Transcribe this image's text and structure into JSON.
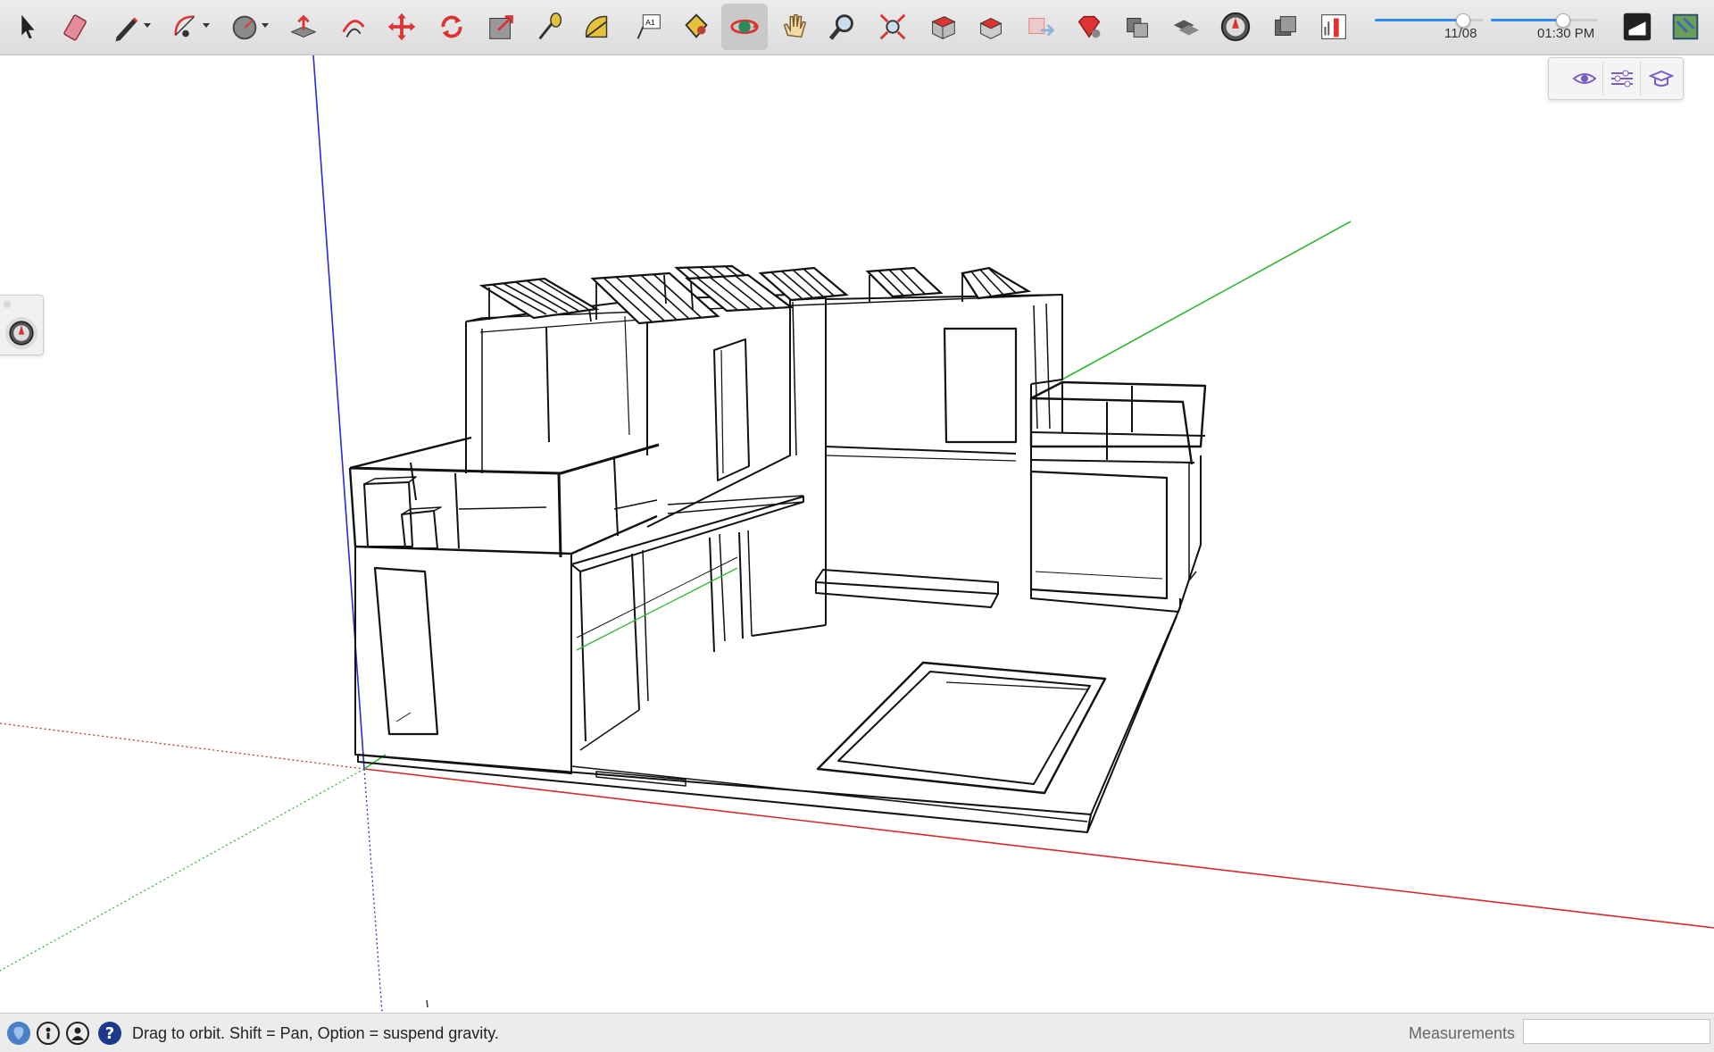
{
  "toolbar": {
    "tools": [
      {
        "name": "select-tool",
        "icon": "arrow-cursor-icon"
      },
      {
        "name": "eraser-tool",
        "icon": "eraser-icon"
      },
      {
        "name": "line-tool",
        "icon": "pencil-icon"
      },
      {
        "name": "arc-tool",
        "icon": "arc-icon"
      },
      {
        "name": "shape-tool",
        "icon": "circle-icon"
      },
      {
        "name": "push-pull-tool",
        "icon": "push-pull-icon"
      },
      {
        "name": "offset-tool",
        "icon": "offset-icon"
      },
      {
        "name": "move-tool",
        "icon": "move-arrows-icon"
      },
      {
        "name": "rotate-tool",
        "icon": "rotate-icon"
      },
      {
        "name": "scale-tool",
        "icon": "scale-icon"
      },
      {
        "name": "tape-measure-tool",
        "icon": "tape-measure-icon"
      },
      {
        "name": "protractor-tool",
        "icon": "protractor-icon"
      },
      {
        "name": "text-tool",
        "icon": "text-a1-icon"
      },
      {
        "name": "paint-bucket-tool",
        "icon": "paint-bucket-icon"
      },
      {
        "name": "orbit-tool",
        "icon": "orbit-icon"
      },
      {
        "name": "pan-tool",
        "icon": "hand-icon"
      },
      {
        "name": "zoom-tool",
        "icon": "magnifier-icon"
      },
      {
        "name": "zoom-extents-tool",
        "icon": "zoom-extents-icon"
      },
      {
        "name": "3d-warehouse-button",
        "icon": "warehouse-icon"
      },
      {
        "name": "extension-warehouse-button",
        "icon": "extension-warehouse-icon"
      },
      {
        "name": "send-to-layout-button",
        "icon": "layout-icon"
      },
      {
        "name": "extension-manager-button",
        "icon": "ruby-gem-icon"
      },
      {
        "name": "components-button",
        "icon": "components-icon"
      },
      {
        "name": "materials-button",
        "icon": "materials-icon"
      },
      {
        "name": "geo-location-button",
        "icon": "globe-icon"
      },
      {
        "name": "styles-button",
        "icon": "styles-icon"
      },
      {
        "name": "sandbox-button",
        "icon": "sandbox-icon"
      }
    ],
    "shadow_date": "11/08",
    "shadow_time": "01:30 PM",
    "shadow_date_pos": 0.8,
    "shadow_time_pos": 0.67
  },
  "tray": {
    "buttons": [
      {
        "name": "tray-entity-info-button",
        "icon": "eye-icon"
      },
      {
        "name": "tray-settings-button",
        "icon": "sliders-icon"
      },
      {
        "name": "tray-instructor-button",
        "icon": "graduation-cap-icon"
      }
    ]
  },
  "left_palette": {
    "icon": "geo-location-icon"
  },
  "status": {
    "message": "Drag to orbit. Shift = Pan, Option = suspend gravity.",
    "measurements_label": "Measurements",
    "measurements_value": ""
  },
  "colors": {
    "axis_red": "#d62a2a",
    "axis_green": "#2fb82f",
    "axis_blue": "#2a2ad6",
    "active_tool_bg": "#c9c9c9",
    "slider_blue": "#2f8cf0"
  }
}
